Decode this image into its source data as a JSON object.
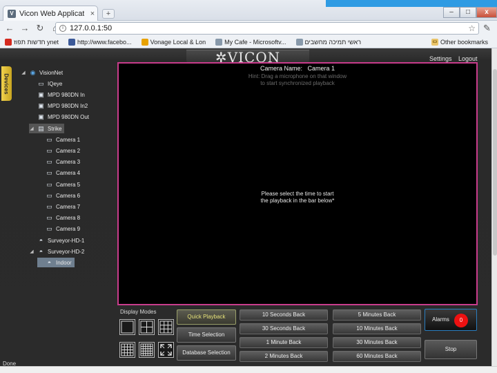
{
  "browser": {
    "tab_title": "Vicon Web Application",
    "tab_close": "×",
    "new_tab": "+",
    "window_buttons": {
      "minimize": "–",
      "maximize": "□",
      "close": "x"
    },
    "url": "127.0.0.1:50",
    "bookmarks": [
      {
        "label": "חדשות תפוז ynet",
        "icon": "ynet-icon",
        "color": "#d42a1f"
      },
      {
        "label": "http://www.facebo...",
        "icon": "facebook-icon",
        "color": "#3b5998"
      },
      {
        "label": "Vonage Local & Lon",
        "icon": "vonage-icon",
        "color": "#e8a200"
      },
      {
        "label": "My Cafe - Microsoftv...",
        "icon": "page-icon",
        "color": "#8899aa"
      },
      {
        "label": "ראשי תמיכה מחשבים",
        "icon": "page-icon",
        "color": "#8899aa"
      }
    ],
    "other_bookmarks": "Other bookmarks"
  },
  "app": {
    "logo": "✲VICON",
    "settings": "Settings",
    "logout": "Logout",
    "side_tab": "Devices",
    "tree": [
      {
        "label": "VisionNet",
        "level": 0,
        "icon": "globe-icon",
        "arrow": "◢"
      },
      {
        "label": "IQeye",
        "level": 1,
        "icon": "camera-icon",
        "arrow": ""
      },
      {
        "label": "MPD 980DN In",
        "level": 1,
        "icon": "device-icon",
        "arrow": ""
      },
      {
        "label": "MPD 980DN In2",
        "level": 1,
        "icon": "device-icon",
        "arrow": ""
      },
      {
        "label": "MPD 980DN Out",
        "level": 1,
        "icon": "device-icon",
        "arrow": ""
      },
      {
        "label": "Strike",
        "level": 1,
        "icon": "recorder-icon",
        "arrow": "◢"
      },
      {
        "label": "Camera 1",
        "level": 2,
        "icon": "camera-icon",
        "arrow": ""
      },
      {
        "label": "Camera 2",
        "level": 2,
        "icon": "camera-icon",
        "arrow": ""
      },
      {
        "label": "Camera 3",
        "level": 2,
        "icon": "camera-icon",
        "arrow": ""
      },
      {
        "label": "Camera 4",
        "level": 2,
        "icon": "camera-icon",
        "arrow": ""
      },
      {
        "label": "Camera 5",
        "level": 2,
        "icon": "camera-icon",
        "arrow": ""
      },
      {
        "label": "Camera 6",
        "level": 2,
        "icon": "camera-icon",
        "arrow": ""
      },
      {
        "label": "Camera 7",
        "level": 2,
        "icon": "camera-icon",
        "arrow": ""
      },
      {
        "label": "Camera 8",
        "level": 2,
        "icon": "camera-icon",
        "arrow": ""
      },
      {
        "label": "Camera 9",
        "level": 2,
        "icon": "camera-icon",
        "arrow": ""
      },
      {
        "label": "Surveyor-HD-1",
        "level": 1,
        "icon": "dome-icon",
        "arrow": ""
      },
      {
        "label": "Surveyor-HD-2",
        "level": 1,
        "icon": "dome-icon",
        "arrow": "◢"
      },
      {
        "label": "Indoor",
        "level": 2,
        "icon": "dome-icon",
        "arrow": ""
      }
    ],
    "viewport": {
      "camera_name_label": "Camera Name:",
      "camera_name": "Camera 1",
      "hint_line1": "Hint: Drag a microphone on that window",
      "hint_line2": "to start synchronized playback",
      "message_line1": "Please select the time to start",
      "message_line2": "the playback in the bar below*"
    },
    "display_modes_label": "Display Modes",
    "playback_buttons": [
      "Quick Playback",
      "Time Selection",
      "Database Selection"
    ],
    "seek_buttons": [
      [
        "10 Seconds Back",
        "5 Minutes Back"
      ],
      [
        "30 Seconds Back",
        "10 Minutes Back"
      ],
      [
        "1 Minute Back",
        "30 Minutes Back"
      ],
      [
        "2 Minutes Back",
        "60 Minutes Back"
      ]
    ],
    "alarms_label": "Alarms",
    "alarms_count": "0",
    "stop_label": "Stop",
    "status_text": "Done"
  }
}
